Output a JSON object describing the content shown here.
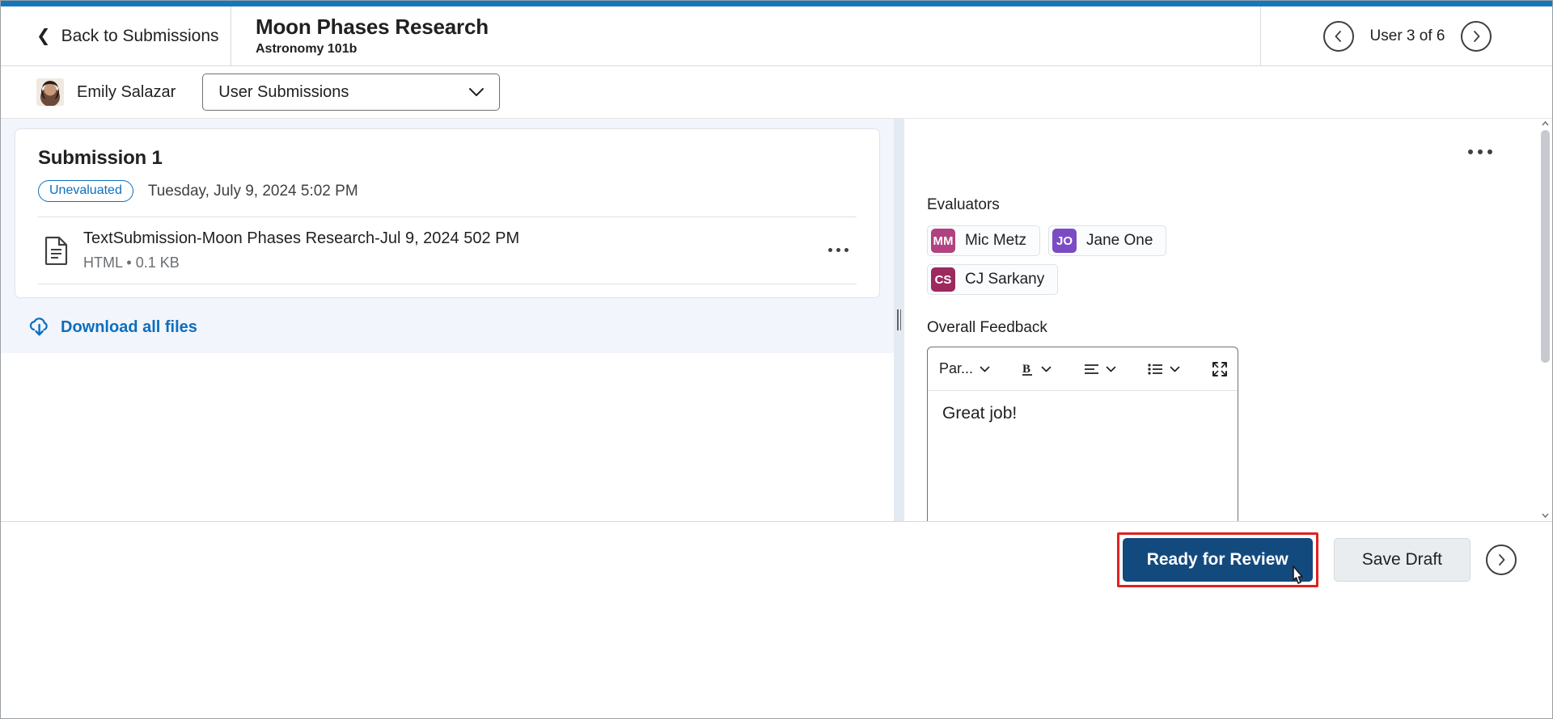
{
  "header": {
    "back_label": "Back to Submissions",
    "back_icon": "chevron-left-icon",
    "title": "Moon Phases Research",
    "subtitle": "Astronomy 101b",
    "prev_icon": "chevron-left-circle-icon",
    "next_icon": "chevron-right-circle-icon",
    "user_count": "User 3 of 6"
  },
  "user_bar": {
    "avatar_name": "user-avatar",
    "user_name": "Emily Salazar",
    "select_value": "User Submissions",
    "select_icon": "chevron-down-icon"
  },
  "submission": {
    "title": "Submission 1",
    "status_badge": "Unevaluated",
    "date": "Tuesday, July 9, 2024 5:02 PM",
    "file": {
      "icon": "document-icon",
      "name": "TextSubmission-Moon Phases Research-Jul 9, 2024 502 PM",
      "type": "HTML",
      "separator": "•",
      "size": "0.1 KB",
      "menu_icon": "ellipsis-icon"
    },
    "download_label": "Download all files",
    "download_icon": "cloud-download-icon"
  },
  "right_panel": {
    "menu_icon": "ellipsis-icon",
    "evaluators_label": "Evaluators",
    "evaluators": [
      {
        "initials": "MM",
        "name": "Mic Metz",
        "color": "#b0427f"
      },
      {
        "initials": "JO",
        "name": "Jane One",
        "color": "#7b4bc4"
      },
      {
        "initials": "CS",
        "name": "CJ Sarkany",
        "color": "#9c2a5e"
      }
    ],
    "feedback_label": "Overall Feedback",
    "toolbar": {
      "paragraph_label": "Par...",
      "paragraph_icon": "chevron-down-icon",
      "bold_icon": "bold-icon",
      "bold_chevron_icon": "chevron-down-icon",
      "align_icon": "align-left-icon",
      "align_chevron_icon": "chevron-down-icon",
      "list_icon": "bullet-list-icon",
      "list_chevron_icon": "chevron-down-icon",
      "fullscreen_icon": "expand-icon"
    },
    "feedback_text": "Great job!"
  },
  "footer": {
    "primary_label": "Ready for Review",
    "secondary_label": "Save Draft",
    "next_icon": "chevron-right-circle-icon",
    "cursor_icon": "pointer-cursor-icon",
    "highlight_color": "#e02020"
  },
  "colors": {
    "accent_blue": "#1277bc",
    "link_blue": "#0c6ebd",
    "primary_button": "#134a7e",
    "panel_bg": "#f2f5fb"
  }
}
